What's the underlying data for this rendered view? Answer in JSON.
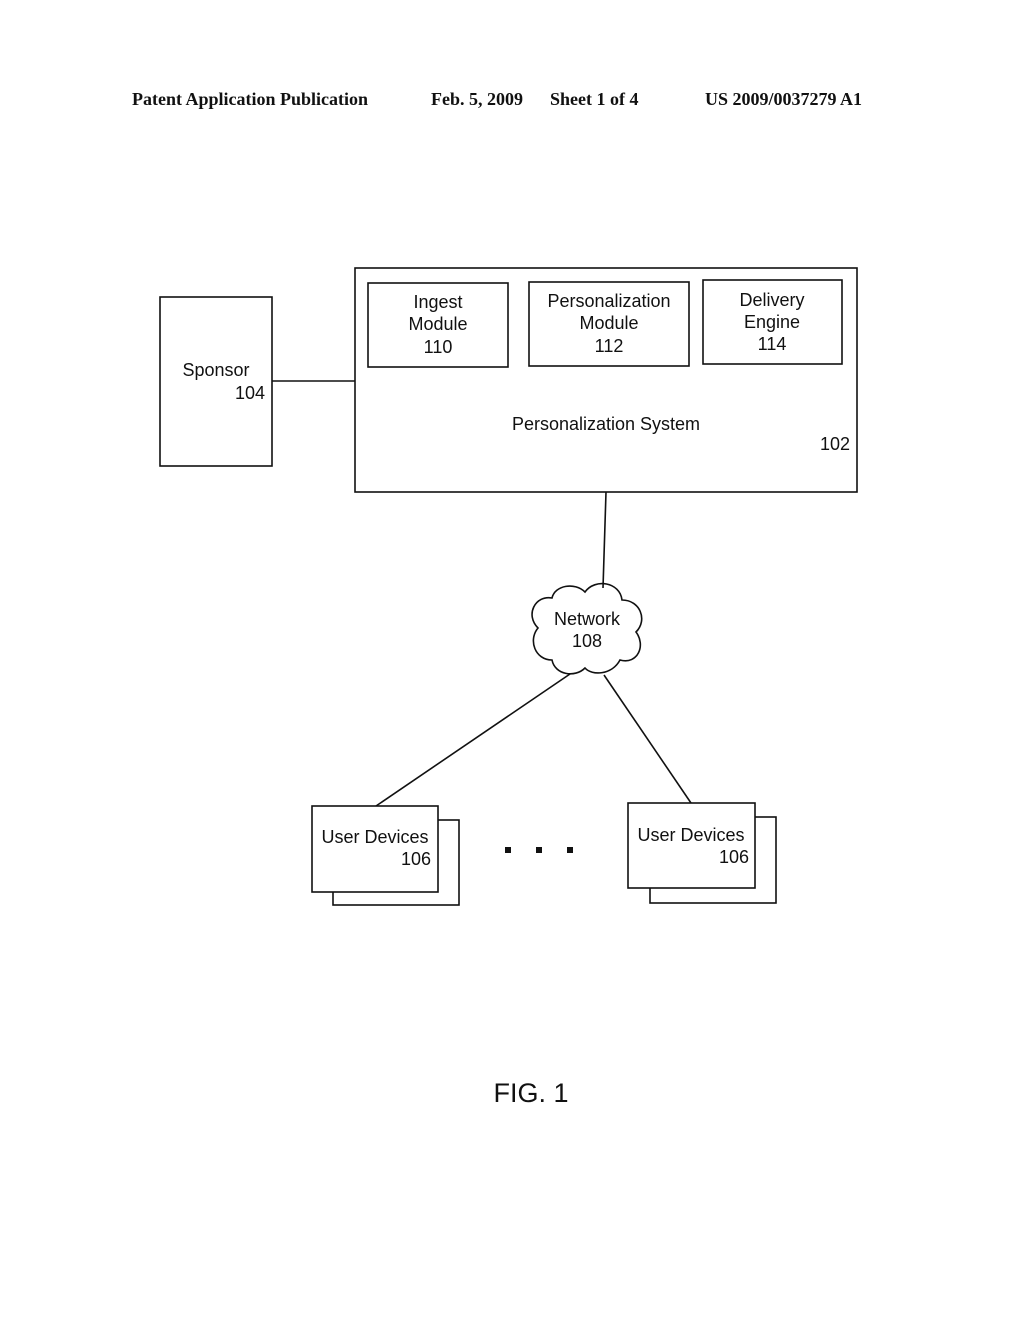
{
  "header": {
    "publication_type": "Patent Application Publication",
    "date": "Feb. 5, 2009",
    "sheet": "Sheet 1 of 4",
    "publication_number": "US 2009/0037279 A1"
  },
  "diagram": {
    "sponsor": {
      "label": "Sponsor",
      "ref": "104"
    },
    "system": {
      "label": "Personalization System",
      "ref": "102",
      "modules": [
        {
          "line1": "Ingest",
          "line2": "Module",
          "ref": "110"
        },
        {
          "line1": "Personalization",
          "line2": "Module",
          "ref": "112"
        },
        {
          "line1": "Delivery",
          "line2": "Engine",
          "ref": "114"
        }
      ]
    },
    "network": {
      "label": "Network",
      "ref": "108"
    },
    "user_devices": [
      {
        "label": "User Devices",
        "ref": "106"
      },
      {
        "label": "User Devices",
        "ref": "106"
      }
    ],
    "ellipsis": "▪  ▪  ▪"
  },
  "figure_label": "FIG. 1"
}
